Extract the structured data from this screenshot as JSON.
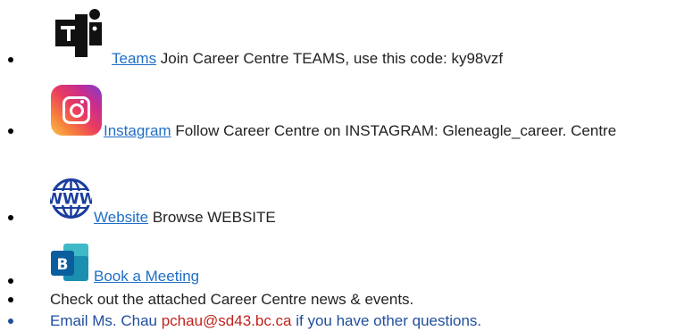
{
  "items": [
    {
      "icon": "teams-icon",
      "link": "Teams",
      "text": " Join Career Centre TEAMS, use this code: ky98vzf"
    },
    {
      "icon": "instagram-icon",
      "link": "Instagram",
      "text": " Follow Career Centre on INSTAGRAM: Gleneagle_career. Centre"
    },
    {
      "icon": "www-icon",
      "icon_text": "WWW",
      "link": "Website",
      "text": " Browse WEBSITE"
    },
    {
      "icon": "bookings-icon",
      "icon_text": "B",
      "link": "Book a Meeting"
    },
    {
      "text": "Check out the attached Career Centre news & events."
    },
    {
      "text_before": "Email Ms. Chau ",
      "email": "pchau@sd43.bc.ca",
      "text_after": " if you have other questions."
    }
  ],
  "colors": {
    "link": "#1f6fc6",
    "email": "#c0231e",
    "email_line": "#1f4e9c"
  }
}
